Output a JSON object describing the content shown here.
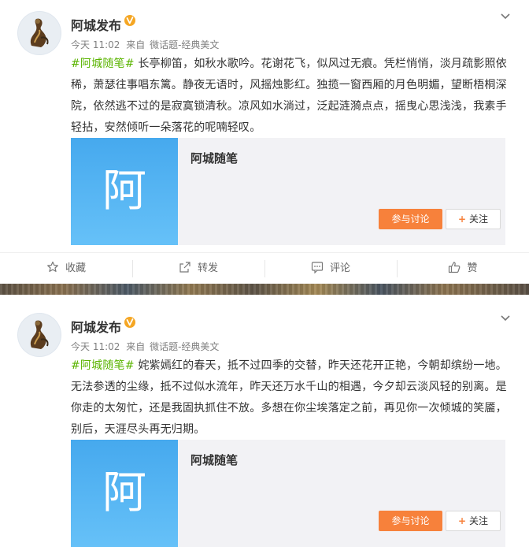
{
  "posts": [
    {
      "user": {
        "name": "阿城发布"
      },
      "meta": {
        "time": "今天 11:02",
        "source_prefix": "来自",
        "source": "微话题-经典美文"
      },
      "hashtag": "#阿城随笔#",
      "text": " 长亭柳笛，如秋水歌吟。花谢花飞，似风过无痕。凭栏悄悄，淡月疏影照依稀，萧瑟往事唱东篱。静夜无语时，风摇烛影红。独揽一窗西厢的月色明媚，望断梧桐深院，依然逃不过的是寂寞锁清秋。凉风如水淌过，泛起涟漪点点，摇曳心思浅浅，我素手轻拈，安然倾听一朵落花的呢喃轻叹。",
      "share": {
        "thumb_char": "阿",
        "title": "阿城随笔",
        "discuss_label": "参与讨论",
        "follow_plus": "+",
        "follow_label": "关注"
      },
      "actions": {
        "favorite": "收藏",
        "repost": "转发",
        "comment": "评论",
        "like": "赞"
      }
    },
    {
      "user": {
        "name": "阿城发布"
      },
      "meta": {
        "time": "今天 11:02",
        "source_prefix": "来自",
        "source": "微话题-经典美文"
      },
      "hashtag": "#阿城随笔#",
      "text": " 姹紫嫣红的春天，抵不过四季的交替，昨天还花开正艳，今朝却缤纷一地。无法参透的尘缘，抵不过似水流年，昨天还万水千山的相遇，今夕却云淡风轻的别离。是你走的太匆忙，还是我固执抓住不放。多想在你尘埃落定之前，再见你一次倾城的笑靥，别后，天涯尽头再无归期。",
      "share": {
        "thumb_char": "阿",
        "title": "阿城随笔",
        "discuss_label": "参与讨论",
        "follow_plus": "+",
        "follow_label": "关注"
      }
    }
  ],
  "colors": {
    "hashtag": "#5ab400",
    "discuss_button": "#f7813b",
    "verified": "#f5a623",
    "thumb": "#4fb3f3"
  },
  "icons": [
    "avatar",
    "verified-icon",
    "chevron-down-icon",
    "star-icon",
    "share-icon",
    "comment-icon",
    "thumbs-up-icon"
  ]
}
